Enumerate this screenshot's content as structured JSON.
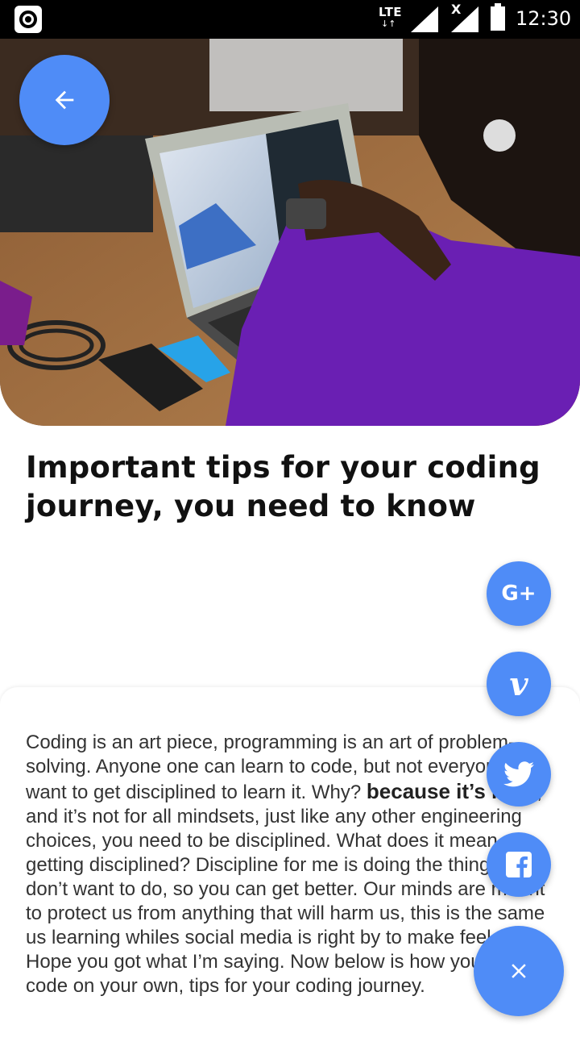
{
  "status_bar": {
    "network": "LTE",
    "time": "12:30"
  },
  "hero": {
    "image_description_icon": "laptop-photo"
  },
  "article": {
    "title": "Important tips for your coding journey, you need to know",
    "body_start": "Coding is an art piece, programming is an art of problem-solving. Anyone one can learn to code, but not everyone will want to get disciplined to learn it. Why? ",
    "body_bold": "because it’s hard",
    "body_end": ", and it’s not for all mindsets, just like any other engineering choices, you need to be disciplined. What does it mean getting disciplined? Discipline for me is doing the things you don’t want to do, so you can get better. Our minds are meant to protect us from anything that will harm us, this is the same us learning whiles social media is right by to make feel okay. Hope you got what I’m saying. Now below is how you learn to code on your own, tips for your coding journey."
  },
  "share": {
    "gplus_label": "G+",
    "vimeo_label": "v"
  },
  "colors": {
    "accent": "#4f8cf7"
  }
}
